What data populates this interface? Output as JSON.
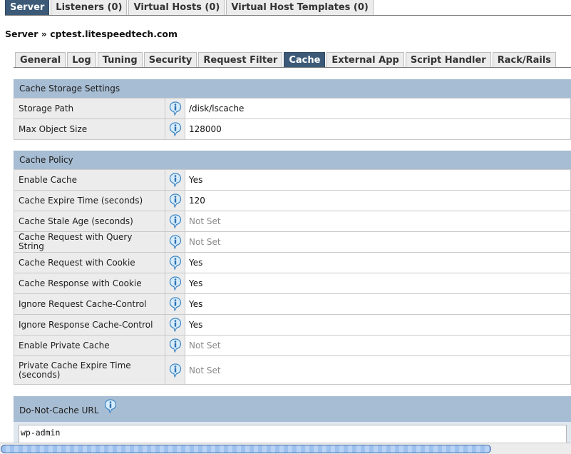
{
  "top_tabs": [
    "Server",
    "Listeners (0)",
    "Virtual Hosts (0)",
    "Virtual Host Templates (0)"
  ],
  "top_active": 0,
  "breadcrumb": "Server » cptest.litespeedtech.com",
  "sub_tabs": [
    "General",
    "Log",
    "Tuning",
    "Security",
    "Request Filter",
    "Cache",
    "External App",
    "Script Handler",
    "Rack/Rails"
  ],
  "sub_active": 5,
  "storage": {
    "title": "Cache Storage Settings",
    "rows": [
      {
        "label": "Storage Path",
        "value": "/disk/lscache",
        "notset": false
      },
      {
        "label": "Max Object Size",
        "value": "128000",
        "notset": false
      }
    ]
  },
  "policy": {
    "title": "Cache Policy",
    "rows": [
      {
        "label": "Enable Cache",
        "value": "Yes",
        "notset": false
      },
      {
        "label": "Cache Expire Time (seconds)",
        "value": "120",
        "notset": false
      },
      {
        "label": "Cache Stale Age (seconds)",
        "value": "Not Set",
        "notset": true
      },
      {
        "label": "Cache Request with Query String",
        "value": "Not Set",
        "notset": true
      },
      {
        "label": "Cache Request with Cookie",
        "value": "Yes",
        "notset": false
      },
      {
        "label": "Cache Response with Cookie",
        "value": "Yes",
        "notset": false
      },
      {
        "label": "Ignore Request Cache-Control",
        "value": "Yes",
        "notset": false
      },
      {
        "label": "Ignore Response Cache-Control",
        "value": "Yes",
        "notset": false
      },
      {
        "label": "Enable Private Cache",
        "value": "Not Set",
        "notset": true
      },
      {
        "label": "Private Cache Expire Time (seconds)",
        "value": "Not Set",
        "notset": true
      }
    ]
  },
  "dnc": {
    "label": "Do-Not-Cache URL",
    "value": "wp-admin"
  },
  "icons": {
    "help": "info-icon"
  },
  "colors": {
    "tab_active": "#3c5a78",
    "section_header": "#a7bdd3",
    "label_bg": "#ececec",
    "notset_text": "#8a8a8a"
  }
}
